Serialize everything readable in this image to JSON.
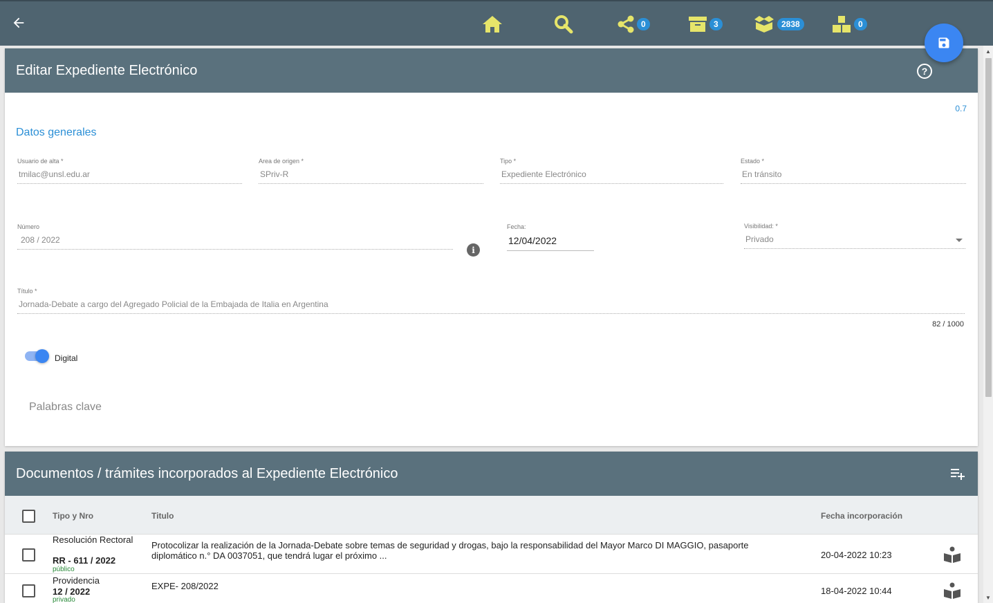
{
  "topbar": {
    "share_count": "0",
    "archive_count": "3",
    "inbox_count": "2838",
    "boxes_count": "0",
    "icons": [
      "arrow-left-icon",
      "home-icon",
      "search-icon",
      "share-icon",
      "archive-icon",
      "inbox-box-icon",
      "boxes-icon",
      "save-icon"
    ],
    "accent_color": "#e6e56a",
    "badge_color": "#2b8fd6"
  },
  "form": {
    "header": "Editar Expediente Electrónico",
    "version": "0.7",
    "section": "Datos generales",
    "usuario": {
      "label": "Usuario de alta *",
      "value": "tmilac@unsl.edu.ar"
    },
    "area": {
      "label": "Area de origen *",
      "value": "SPriv-R"
    },
    "tipo": {
      "label": "Tipo *",
      "value": "Expediente Electrónico"
    },
    "estado": {
      "label": "Estado *",
      "value": "En tránsito"
    },
    "numero": {
      "label": "Número",
      "value": "208 /  2022"
    },
    "fecha": {
      "label": "Fecha:",
      "value": "12/04/2022"
    },
    "visibilidad": {
      "label": "Visibilidad: *",
      "value": "Privado"
    },
    "titulo": {
      "label": "Título *",
      "value": "Jornada-Debate a cargo del Agregado Policial de la Embajada de Italia en Argentina",
      "counter": "82 / 1000"
    },
    "digital": {
      "label": "Digital",
      "checked": true
    },
    "keywords_placeholder": "Palabras clave"
  },
  "documents": {
    "header": "Documentos / trámites incorporados al Expediente Electrónico",
    "columns": {
      "tipo": "Tipo y Nro",
      "titulo": "Titulo",
      "fecha": "Fecha incorporación"
    },
    "rows": [
      {
        "tipo": "Resolución Rectoral",
        "numero": "RR - 611 / 2022",
        "visibilidad": "público",
        "titulo": "Protocolizar la realización de la Jornada-Debate sobre temas de seguridad y drogas, bajo la responsabilidad del Mayor Marco DI MAGGIO, pasaporte diplomático n.° DA 0037051, que tendrá lugar el próximo ...",
        "fecha": "20-04-2022 10:23"
      },
      {
        "tipo": "Providencia",
        "numero": "12 / 2022",
        "visibilidad": "privado",
        "titulo": "EXPE- 208/2022",
        "fecha": "18-04-2022 10:44"
      }
    ]
  }
}
